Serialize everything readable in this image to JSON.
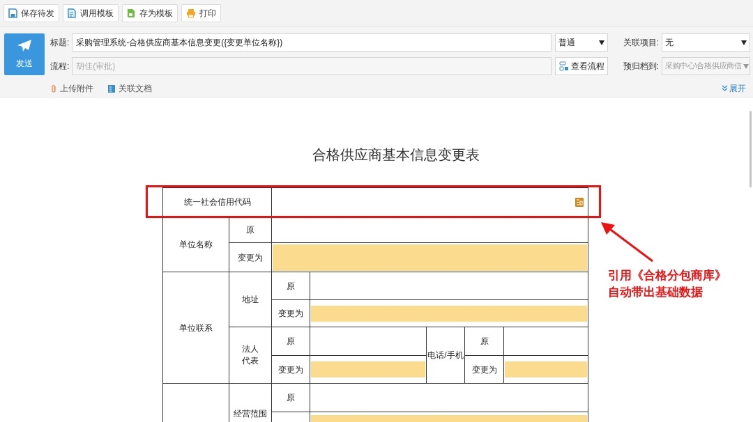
{
  "toolbar": [
    {
      "label": "保存待发",
      "kind": "save"
    },
    {
      "label": "调用模板",
      "kind": "template"
    },
    {
      "label": "存为模板",
      "kind": "saveas"
    },
    {
      "label": "打印",
      "kind": "print"
    }
  ],
  "header": {
    "send_button": "发送",
    "title_label": "标题:",
    "title_value": "采购管理系统-合格供应商基本信息变更({变更单位名称})",
    "priority": "普通",
    "related_label": "关联项目:",
    "related_value": "无",
    "flow_label": "流程:",
    "flow_value": "胡佳(审批)",
    "view_flow_button": "查看流程",
    "archive_label": "预归档到:",
    "archive_value": "采购中心\\合格供应商信",
    "archive_disabled": true,
    "upload_link": "上传附件",
    "related_doc_link": "关联文档",
    "expand_link": "展开"
  },
  "form": {
    "title": "合格供应商基本信息变更表",
    "credit_code": {
      "label": "统一社会信用代码"
    },
    "unit_name": {
      "label": "单位名称",
      "original_label": "原",
      "changed_label": "变更为"
    },
    "contact": {
      "label": "单位联系",
      "address": {
        "label": "地址",
        "original_label": "原",
        "changed_label": "变更为"
      },
      "legal": {
        "label": "法人代表",
        "original_label": "原",
        "changed_label": "变更为",
        "phone_label": "电话/手机",
        "phone_original_label": "原",
        "phone_changed_label": "变更为"
      }
    },
    "business_scope": {
      "label": "经营范围",
      "original_label": "原"
    }
  },
  "annotation": {
    "lines": [
      "引用《合格分包商库》",
      "自动带出基础数据"
    ]
  }
}
